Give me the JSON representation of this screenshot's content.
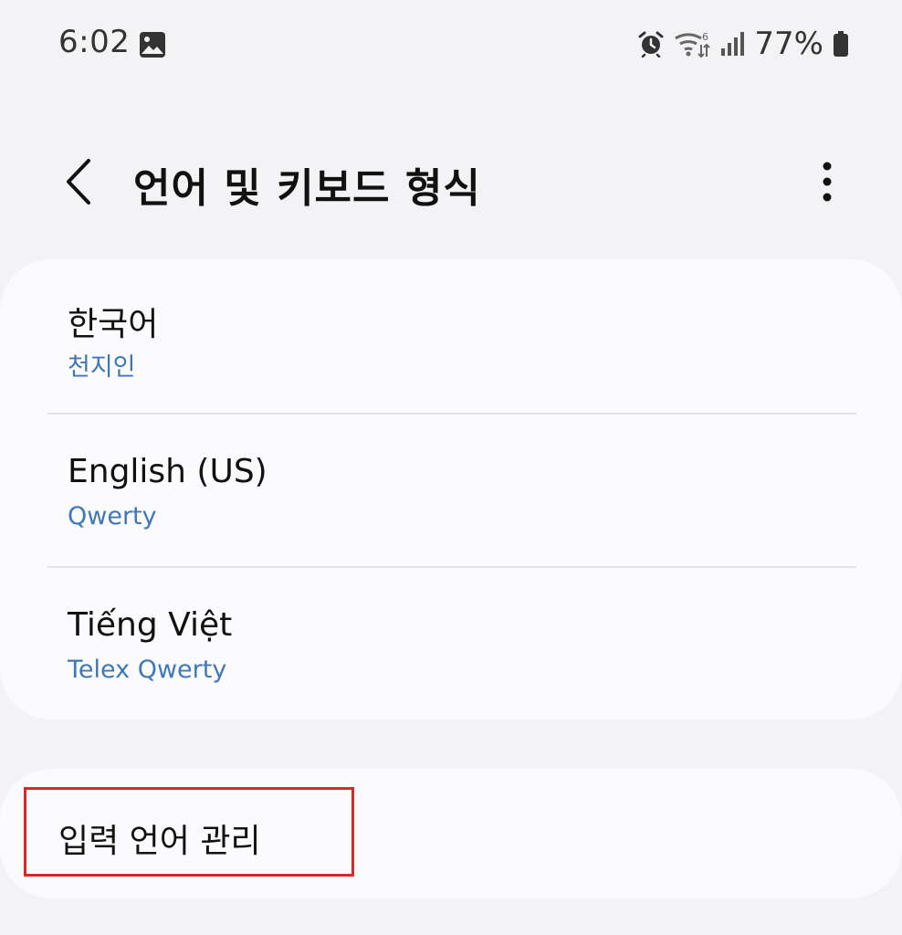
{
  "status_bar": {
    "time": "6:02",
    "battery": "77%",
    "icons": [
      "gallery-icon",
      "alarm-icon",
      "wifi-icon",
      "signal-icon",
      "battery-icon"
    ]
  },
  "header": {
    "title": "언어 및 키보드 형식",
    "back_icon": "chevron-left-icon",
    "more_icon": "more-vertical-icon"
  },
  "languages": [
    {
      "name": "한국어",
      "keyboard": "천지인"
    },
    {
      "name": "English (US)",
      "keyboard": "Qwerty"
    },
    {
      "name": "Tiếng Việt",
      "keyboard": "Telex Qwerty"
    }
  ],
  "manage": {
    "label": "입력 언어 관리"
  },
  "colors": {
    "background": "#f3f3f5",
    "card": "#fbfbfd",
    "subtitle": "#3f78b9",
    "highlight": "#d42a2a"
  }
}
